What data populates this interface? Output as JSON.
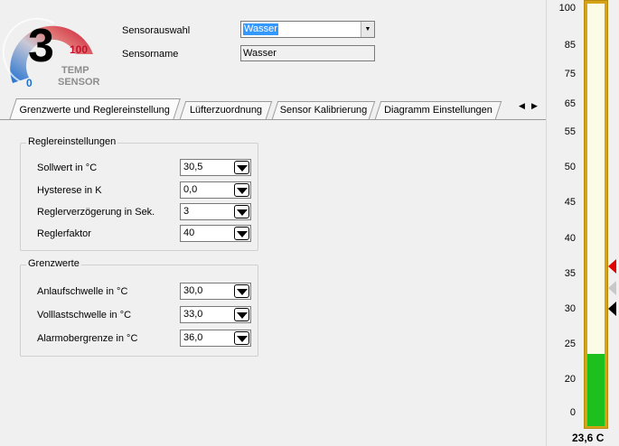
{
  "logo": {
    "number": "3",
    "scale_max": "100",
    "scale_min": "0",
    "word1": "TEMP",
    "word2": "SENSOR",
    "colors": {
      "hot": "#c8102e",
      "cold": "#1e6fd0",
      "text": "#8d8d8d"
    }
  },
  "header": {
    "sensor_select_label": "Sensorauswahl",
    "sensor_select_value": "Wasser",
    "sensor_name_label": "Sensorname",
    "sensor_name_value": "Wasser"
  },
  "tabs": [
    {
      "label": "Grenzwerte und Reglereinstellung",
      "active": true
    },
    {
      "label": "Lüfterzuordnung",
      "active": false
    },
    {
      "label": "Sensor Kalibrierung",
      "active": false
    },
    {
      "label": "Diagramm Einstellungen",
      "active": false
    }
  ],
  "controller": {
    "title": "Reglereinstellungen",
    "rows": [
      {
        "label": "Sollwert in °C",
        "value": "30,5"
      },
      {
        "label": "Hysterese in K",
        "value": "0,0"
      },
      {
        "label": "Reglerverzögerung in Sek.",
        "value": "3"
      },
      {
        "label": "Reglerfaktor",
        "value": "40"
      }
    ]
  },
  "limits": {
    "title": "Grenzwerte",
    "rows": [
      {
        "label": "Anlaufschwelle in °C",
        "value": "30,0"
      },
      {
        "label": "Volllastschwelle in °C",
        "value": "33,0"
      },
      {
        "label": "Alarmobergrenze in °C",
        "value": "36,0"
      }
    ]
  },
  "thermometer": {
    "scale": [
      "100",
      "85",
      "75",
      "65",
      "55",
      "50",
      "45",
      "40",
      "35",
      "30",
      "25",
      "20",
      "0"
    ],
    "readout": "23,6 C",
    "current_value": 23.6,
    "alarm_marker": 36.0,
    "fullload_marker": 33.0,
    "start_marker": 30.0,
    "colors": {
      "frame": "#d6a316",
      "fill": "#1ec01e",
      "alarm": "#e00000",
      "fullload": "#c8c8c8",
      "start": "#000000"
    }
  }
}
